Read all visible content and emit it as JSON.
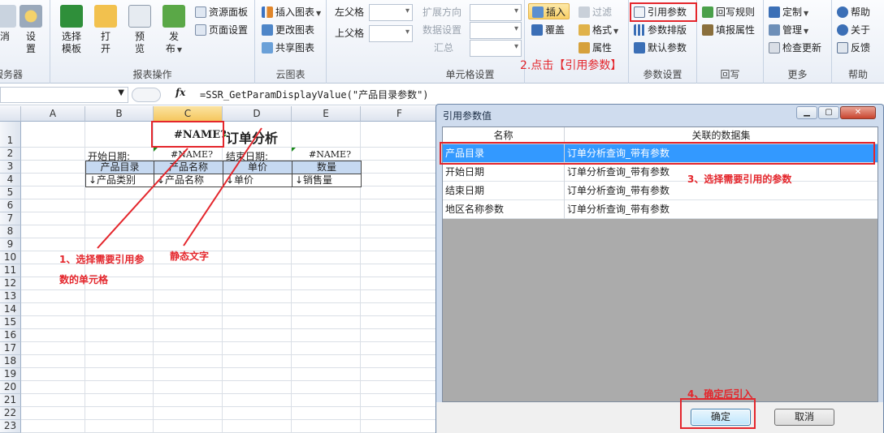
{
  "ribbon": {
    "server_group": {
      "buttons": [
        "消",
        "设\n置"
      ],
      "label": "服务器"
    },
    "report_ops": {
      "label": "报表操作",
      "buttons": [
        {
          "label": "选择\n模板"
        },
        {
          "label": "打\n开"
        },
        {
          "label": "预\n览"
        },
        {
          "label": "发\n布"
        }
      ],
      "small": [
        "资源面板",
        "页面设置"
      ]
    },
    "cloud_chart": {
      "label": "云图表",
      "items": [
        "插入图表",
        "更改图表",
        "共享图表"
      ]
    },
    "parent_cells": {
      "left_parent": "左父格",
      "top_parent": "上父格"
    },
    "cell_settings": {
      "label": "单元格设置",
      "items": [
        "扩展方向",
        "数据设置",
        "汇总"
      ]
    },
    "insert_group": {
      "insert": "插入",
      "cover": "覆盖",
      "filter": "过滤",
      "format": "格式",
      "property": "属性"
    },
    "param_settings": {
      "label": "参数设置",
      "items": [
        "引用参数",
        "参数排版",
        "默认参数"
      ]
    },
    "writeback": {
      "label": "回写",
      "items": [
        "回写规则",
        "填报属性"
      ]
    },
    "more": {
      "label": "更多",
      "items": [
        "定制",
        "管理",
        "检查更新"
      ]
    },
    "help": {
      "label": "帮助",
      "items": [
        "帮助",
        "关于",
        "反馈"
      ]
    }
  },
  "formula_bar": {
    "fx": "fx",
    "formula": "=SSR_GetParamDisplayValue(\"产品目录参数\")"
  },
  "sheet": {
    "columns": [
      "A",
      "B",
      "C",
      "D",
      "E",
      "F"
    ],
    "rows": [
      "1",
      "2",
      "3",
      "4",
      "5",
      "6",
      "7",
      "8",
      "9",
      "10",
      "11",
      "12",
      "13",
      "14",
      "15",
      "16",
      "17",
      "18",
      "19",
      "20",
      "21",
      "22",
      "23"
    ],
    "c1": "#NAME?",
    "title": "订单分析",
    "row2": {
      "start_label": "开始日期:",
      "start_value": "#NAME?",
      "end_label": "结束日期:",
      "end_value": "#NAME?"
    },
    "headers": [
      "产品目录",
      "产品名称",
      "单价",
      "数量"
    ],
    "row4": [
      "↓产品类别",
      "↓产品名称",
      "↓单价",
      "↓销售量"
    ]
  },
  "annotations": {
    "step1_line1": "1、选择需要引用参",
    "step1_line2": "数的单元格",
    "static_text": "静态文字",
    "step2": "2.点击【引用参数】",
    "step3": "3、选择需要引用的参数",
    "step4": "4、确定后引入"
  },
  "dialog": {
    "title": "引用参数值",
    "columns": [
      "名称",
      "关联的数据集"
    ],
    "rows": [
      {
        "name": "产品目录",
        "dataset": "订单分析查询_带有参数",
        "selected": true
      },
      {
        "name": "开始日期",
        "dataset": "订单分析查询_带有参数",
        "selected": false
      },
      {
        "name": "结束日期",
        "dataset": "订单分析查询_带有参数",
        "selected": false
      },
      {
        "name": "地区名称参数",
        "dataset": "订单分析查询_带有参数",
        "selected": false
      }
    ],
    "ok": "确定",
    "cancel": "取消"
  },
  "colors": {
    "accent_red": "#e4262c",
    "selection_blue": "#3399ff",
    "header_fill": "#c6d9f1"
  }
}
